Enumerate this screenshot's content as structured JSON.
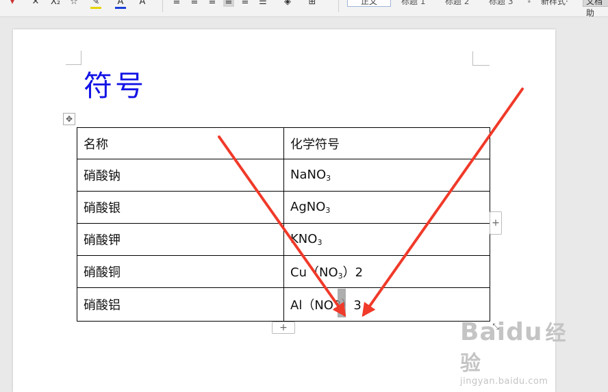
{
  "toolbar": {
    "font_color_glyph": "A",
    "subscript_glyph": "X₂",
    "clear_glyph": "✕",
    "styles": [
      {
        "label": "正文",
        "selected": true
      },
      {
        "label": "标题 1",
        "selected": false
      },
      {
        "label": "标题 2",
        "selected": false
      },
      {
        "label": "标题 3",
        "selected": false
      }
    ],
    "new_style_label": "新样式·",
    "doc_tool_label": "文档助"
  },
  "document": {
    "title": "符号",
    "table": {
      "headers": [
        "名称",
        "化学符号"
      ],
      "rows": [
        {
          "name": "硝酸钠",
          "formula_main": "NaNO",
          "formula_sub": "3",
          "formula_tail": ""
        },
        {
          "name": "硝酸银",
          "formula_main": "AgNO",
          "formula_sub": "3",
          "formula_tail": ""
        },
        {
          "name": "硝酸钾",
          "formula_main": "KNO",
          "formula_sub": "3",
          "formula_tail": ""
        },
        {
          "name": "硝酸铜",
          "formula_main": "Cu（NO",
          "formula_sub": "3",
          "formula_tail": "）2"
        },
        {
          "name": "硝酸铝",
          "formula_main": "Al（NO3）3",
          "formula_sub": "",
          "formula_tail": ""
        }
      ]
    },
    "add_row_glyph": "+",
    "add_col_glyph": "+",
    "move_glyph": "✥",
    "resize_glyph": "⤡"
  },
  "watermark": {
    "brand": "Baidu",
    "brand_cn": "经验",
    "url": "jingyan.baidu.com"
  },
  "colors": {
    "title": "#1414e6",
    "arrow": "#f03a2a"
  }
}
